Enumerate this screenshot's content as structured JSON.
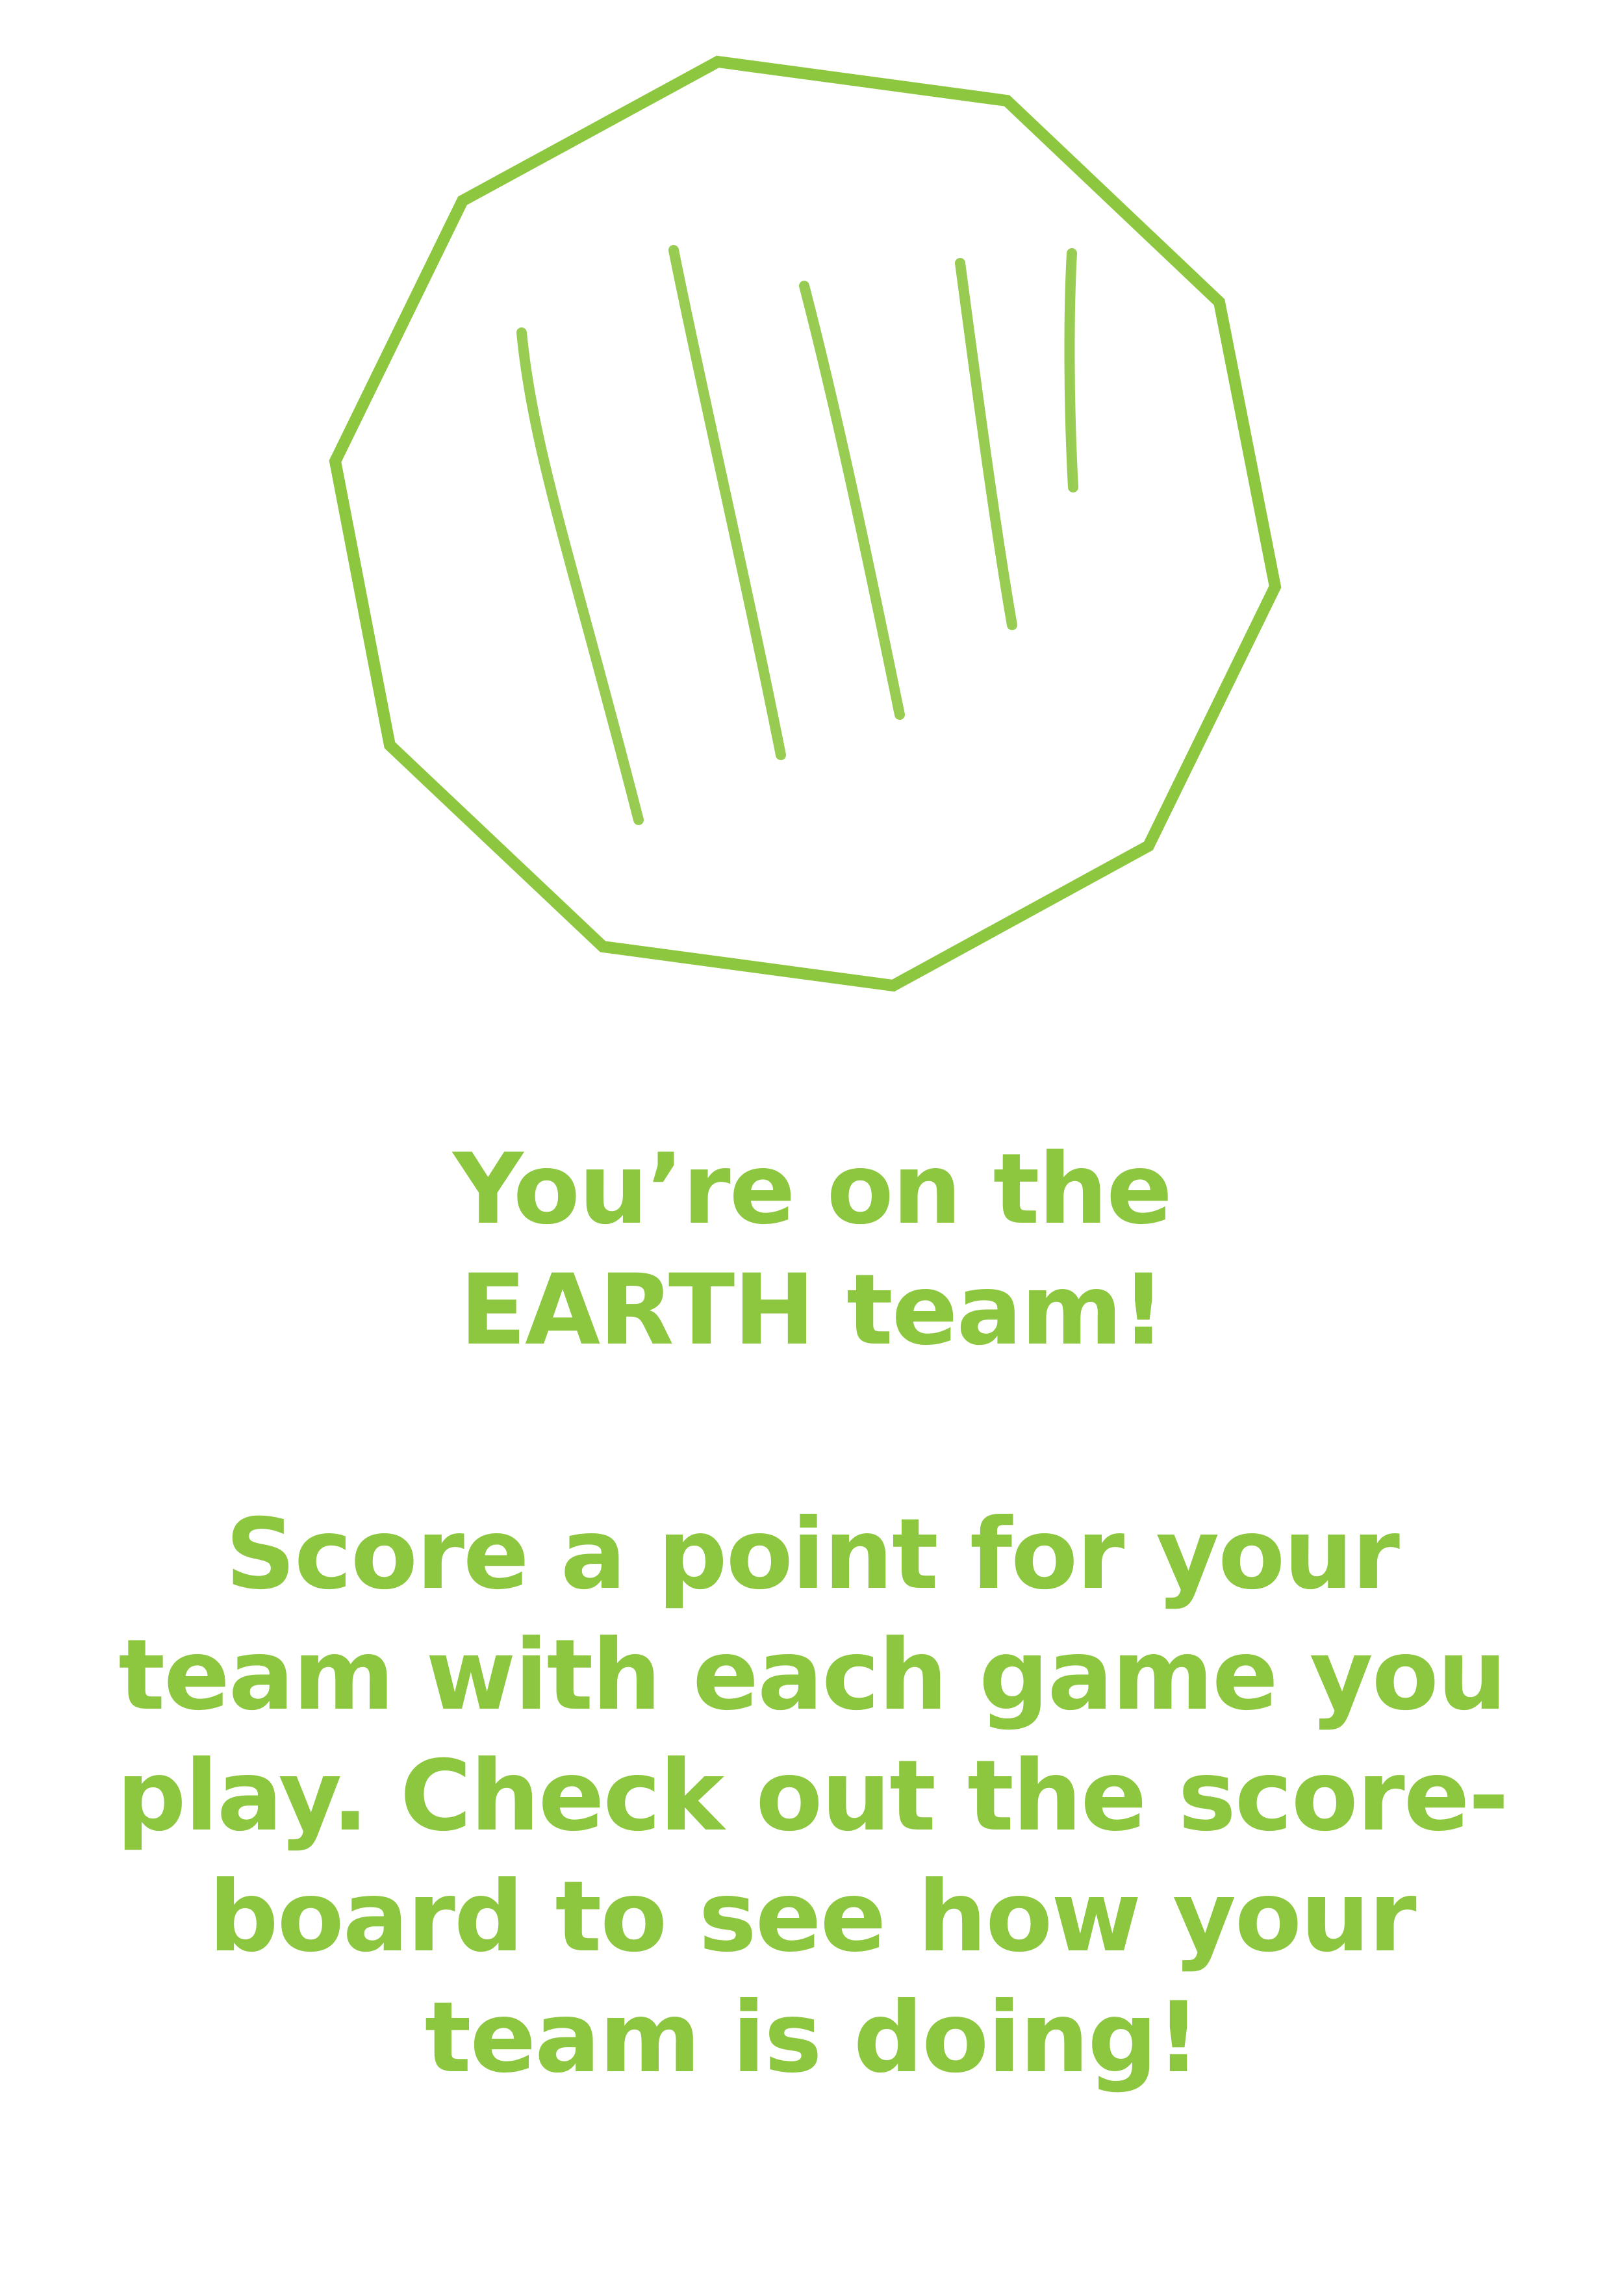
{
  "theme": {
    "accent": "#8dc63f"
  },
  "emblem": {
    "icon": "earth-team-decagon-icon"
  },
  "headline": {
    "lines": [
      "You’re on the",
      "EARTH team!"
    ]
  },
  "body": {
    "lines": [
      "Score a point for your",
      "team with each game you",
      "play. Check out the score-",
      "board to see how your",
      "team is doing!"
    ]
  }
}
